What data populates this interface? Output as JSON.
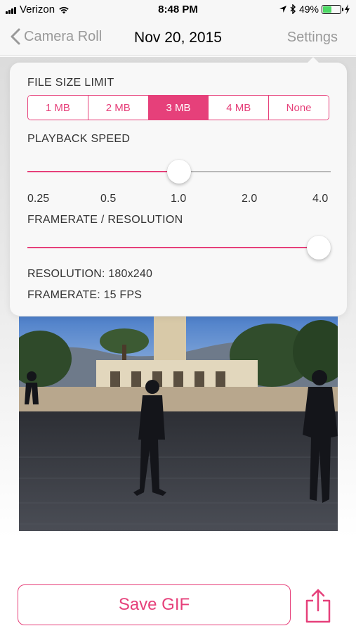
{
  "status_bar": {
    "carrier": "Verizon",
    "time": "8:48 PM",
    "battery": "49%",
    "battery_level": 0.49
  },
  "nav": {
    "back_label": "Camera Roll",
    "title": "Nov 20, 2015",
    "settings_label": "Settings"
  },
  "settings": {
    "file_size_label": "FILE SIZE LIMIT",
    "file_size_options": [
      "1 MB",
      "2 MB",
      "3 MB",
      "4 MB",
      "None"
    ],
    "file_size_selected": "3 MB",
    "playback_label": "PLAYBACK SPEED",
    "playback_ticks": [
      "0.25",
      "0.5",
      "1.0",
      "2.0",
      "4.0"
    ],
    "playback_value": "1.0",
    "framerate_label": "FRAMERATE / RESOLUTION",
    "framerate_level": 1.0,
    "resolution_text": "RESOLUTION: 180x240",
    "framerate_text": "FRAMERATE: 15 FPS"
  },
  "actions": {
    "save_label": "Save GIF"
  },
  "colors": {
    "accent": "#e6407a",
    "battery_green": "#4cd964"
  }
}
